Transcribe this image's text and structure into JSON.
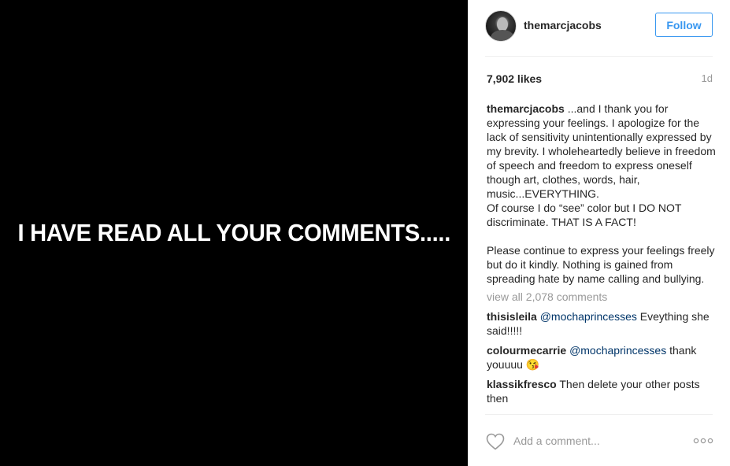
{
  "post_image": {
    "text": "I HAVE READ ALL YOUR COMMENTS....."
  },
  "header": {
    "username": "themarcjacobs",
    "follow_label": "Follow"
  },
  "stats": {
    "likes": "7,902 likes",
    "time": "1d"
  },
  "caption": {
    "username": "themarcjacobs",
    "text": " ...and I thank you for expressing your feelings. I apologize for the lack of sensitivity unintentionally expressed by my brevity. I wholeheartedly believe in freedom of speech and freedom to express oneself though art, clothes, words, hair, music...EVERYTHING.\nOf course I do “see” color but I DO NOT discriminate. THAT IS A FACT!\n\nPlease continue to express your feelings freely but do it kindly. Nothing is gained from spreading hate by name calling and bullying."
  },
  "view_all_comments": "view all 2,078 comments",
  "comments": [
    {
      "user": "thisisleila",
      "mention": "@mochaprincesses",
      "text": " Eveything she said!!!!!"
    },
    {
      "user": "colourmecarrie",
      "mention": "@mochaprincesses",
      "text": " thank youuuu 😘"
    },
    {
      "user": "klassikfresco",
      "mention": "",
      "text": " Then delete your other posts then"
    }
  ],
  "footer": {
    "comment_placeholder": "Add a comment...",
    "icons": [
      "heart-icon",
      "more-options-icon"
    ]
  },
  "colors": {
    "accent": "#3897f0",
    "mention": "#003569",
    "muted": "#999999",
    "image_bg": "#000000"
  }
}
